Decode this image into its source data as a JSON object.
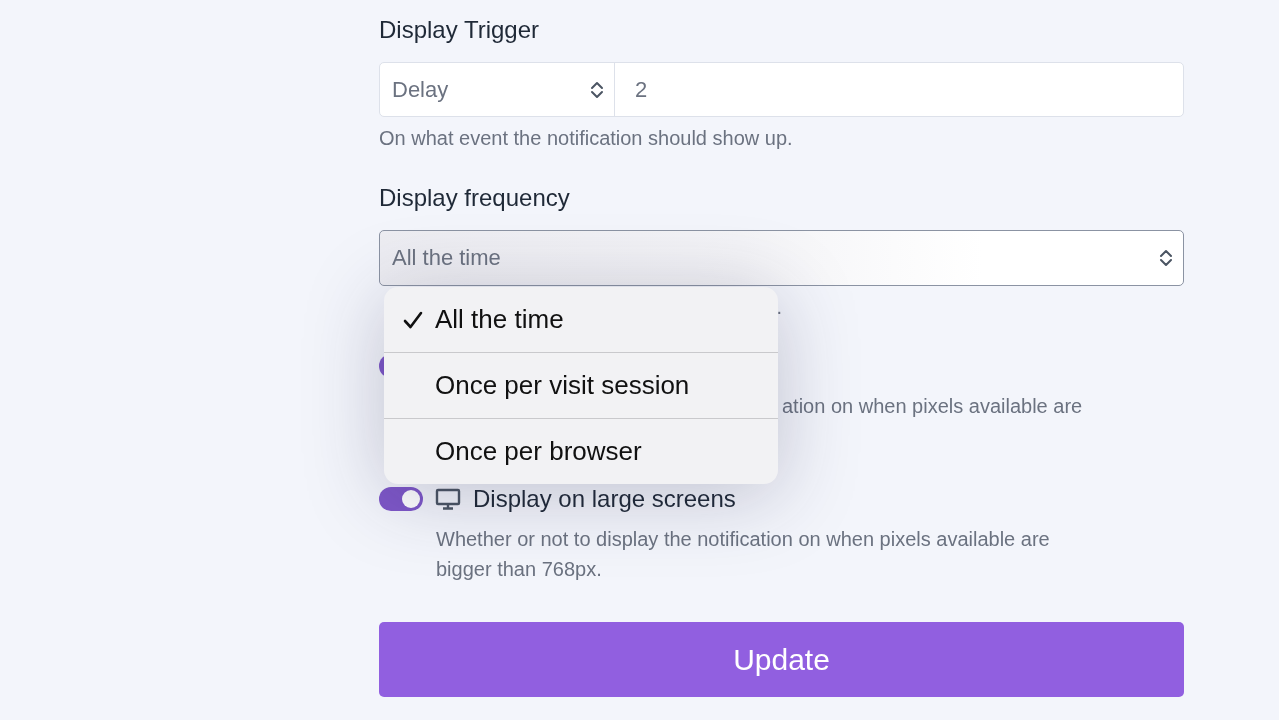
{
  "trigger": {
    "label": "Display Trigger",
    "select_value": "Delay",
    "value": "2",
    "help": "On what event the notification should show up."
  },
  "frequency": {
    "label": "Display frequency",
    "value": "All the time",
    "help_visible": [
      "."
    ],
    "menu": [
      {
        "label": "All the time",
        "selected": true
      },
      {
        "label": "Once per visit session",
        "selected": false
      },
      {
        "label": "Once per browser",
        "selected": false
      }
    ]
  },
  "toggles": [
    {
      "kind": "small",
      "on": true,
      "description": "ation on when pixels available are"
    },
    {
      "kind": "large",
      "on": true,
      "label": "Display on large screens",
      "description": "Whether or not to display the notification on when pixels available are bigger than 768px."
    }
  ],
  "button": "Update"
}
